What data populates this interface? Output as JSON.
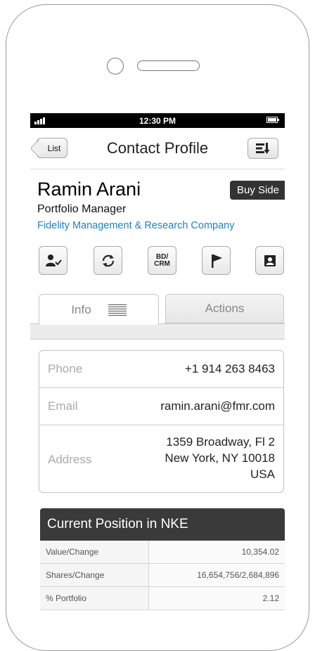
{
  "status_bar": {
    "time": "12:30 PM"
  },
  "nav": {
    "back_label": "List",
    "title": "Contact Profile"
  },
  "contact": {
    "name": "Ramin Arani",
    "badge": "Buy Side",
    "job_title": "Portfolio Manager",
    "company": "Fidelity Management & Research Company"
  },
  "actions": {
    "bd_crm_line1": "BD/",
    "bd_crm_line2": "CRM"
  },
  "tabs": {
    "info": "Info",
    "actions": "Actions"
  },
  "info": {
    "phone_label": "Phone",
    "phone_value": "+1 914 263 8463",
    "email_label": "Email",
    "email_value": "ramin.arani@fmr.com",
    "address_label": "Address",
    "address_line1": "1359 Broadway, Fl 2",
    "address_line2": "New York, NY 10018",
    "address_line3": "USA"
  },
  "position": {
    "title": "Current Position in NKE",
    "rows": [
      {
        "label": "Value/Change",
        "value": "10,354.02"
      },
      {
        "label": "Shares/Change",
        "value": "16,654,756/2,684,896"
      },
      {
        "label": "% Portfolio",
        "value": "2.12"
      }
    ]
  },
  "colors": {
    "link": "#1f7fcc",
    "badge_bg": "#333333",
    "header_bg": "#3a3a3a"
  }
}
